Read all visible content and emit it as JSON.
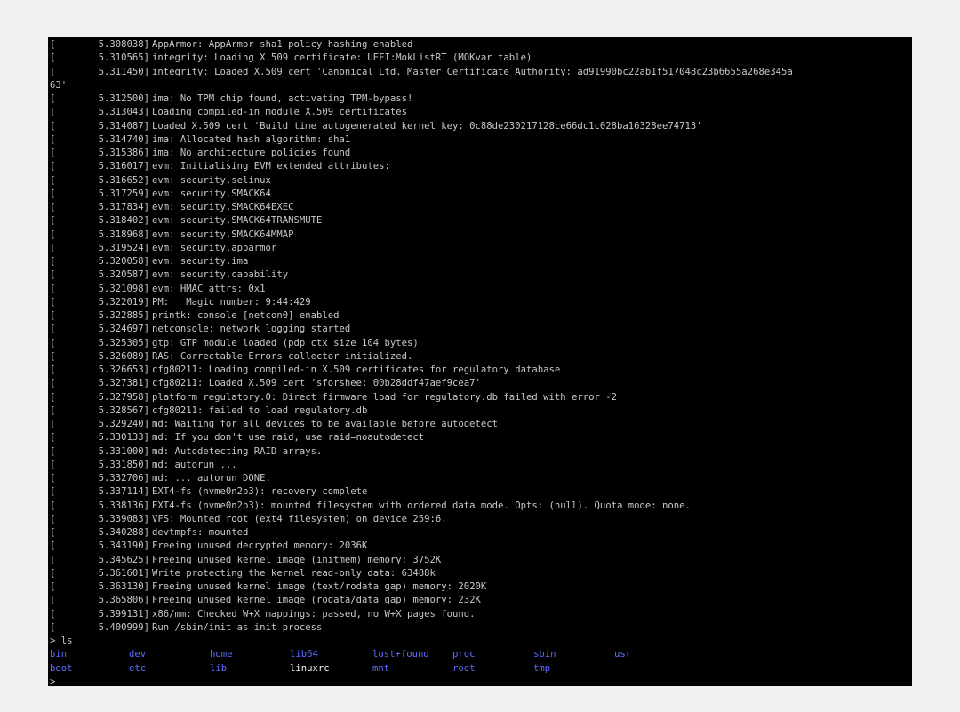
{
  "console": {
    "bracket": "[",
    "log_lines": [
      {
        "ts": "5.308038]",
        "msg": "AppArmor: AppArmor sha1 policy hashing enabled"
      },
      {
        "ts": "5.310565]",
        "msg": "integrity: Loading X.509 certificate: UEFI:MokListRT (MOKvar table)"
      },
      {
        "ts": "5.311450]",
        "msg": "integrity: Loaded X.509 cert 'Canonical Ltd. Master Certificate Authority: ad91990bc22ab1f517048c23b6655a268e345a"
      },
      {
        "wrap": "63'"
      },
      {
        "ts": "5.312500]",
        "msg": "ima: No TPM chip found, activating TPM-bypass!"
      },
      {
        "ts": "5.313043]",
        "msg": "Loading compiled-in module X.509 certificates"
      },
      {
        "ts": "5.314087]",
        "msg": "Loaded X.509 cert 'Build time autogenerated kernel key: 0c88de230217128ce66dc1c028ba16328ee74713'"
      },
      {
        "ts": "5.314740]",
        "msg": "ima: Allocated hash algorithm: sha1"
      },
      {
        "ts": "5.315386]",
        "msg": "ima: No architecture policies found"
      },
      {
        "ts": "5.316017]",
        "msg": "evm: Initialising EVM extended attributes:"
      },
      {
        "ts": "5.316652]",
        "msg": "evm: security.selinux"
      },
      {
        "ts": "5.317259]",
        "msg": "evm: security.SMACK64"
      },
      {
        "ts": "5.317834]",
        "msg": "evm: security.SMACK64EXEC"
      },
      {
        "ts": "5.318402]",
        "msg": "evm: security.SMACK64TRANSMUTE"
      },
      {
        "ts": "5.318968]",
        "msg": "evm: security.SMACK64MMAP"
      },
      {
        "ts": "5.319524]",
        "msg": "evm: security.apparmor"
      },
      {
        "ts": "5.320058]",
        "msg": "evm: security.ima"
      },
      {
        "ts": "5.320587]",
        "msg": "evm: security.capability"
      },
      {
        "ts": "5.321098]",
        "msg": "evm: HMAC attrs: 0x1"
      },
      {
        "ts": "5.322019]",
        "msg": "PM:   Magic number: 9:44:429"
      },
      {
        "ts": "5.322885]",
        "msg": "printk: console [netcon0] enabled"
      },
      {
        "ts": "5.324697]",
        "msg": "netconsole: network logging started"
      },
      {
        "ts": "5.325305]",
        "msg": "gtp: GTP module loaded (pdp ctx size 104 bytes)"
      },
      {
        "ts": "5.326089]",
        "msg": "RAS: Correctable Errors collector initialized."
      },
      {
        "ts": "5.326653]",
        "msg": "cfg80211: Loading compiled-in X.509 certificates for regulatory database"
      },
      {
        "ts": "5.327381]",
        "msg": "cfg80211: Loaded X.509 cert 'sforshee: 00b28ddf47aef9cea7'"
      },
      {
        "ts": "5.327958]",
        "msg": "platform regulatory.0: Direct firmware load for regulatory.db failed with error -2"
      },
      {
        "ts": "5.328567]",
        "msg": "cfg80211: failed to load regulatory.db"
      },
      {
        "ts": "5.329240]",
        "msg": "md: Waiting for all devices to be available before autodetect"
      },
      {
        "ts": "5.330133]",
        "msg": "md: If you don't use raid, use raid=noautodetect"
      },
      {
        "ts": "5.331000]",
        "msg": "md: Autodetecting RAID arrays."
      },
      {
        "ts": "5.331850]",
        "msg": "md: autorun ..."
      },
      {
        "ts": "5.332706]",
        "msg": "md: ... autorun DONE."
      },
      {
        "ts": "5.337114]",
        "msg": "EXT4-fs (nvme0n2p3): recovery complete"
      },
      {
        "ts": "5.338136]",
        "msg": "EXT4-fs (nvme0n2p3): mounted filesystem with ordered data mode. Opts: (null). Quota mode: none."
      },
      {
        "ts": "5.339083]",
        "msg": "VFS: Mounted root (ext4 filesystem) on device 259:6."
      },
      {
        "ts": "5.340288]",
        "msg": "devtmpfs: mounted"
      },
      {
        "ts": "5.343190]",
        "msg": "Freeing unused decrypted memory: 2036K"
      },
      {
        "ts": "5.345625]",
        "msg": "Freeing unused kernel image (initmem) memory: 3752K"
      },
      {
        "ts": "5.361601]",
        "msg": "Write protecting the kernel read-only data: 63488k"
      },
      {
        "ts": "5.363130]",
        "msg": "Freeing unused kernel image (text/rodata gap) memory: 2020K"
      },
      {
        "ts": "5.365806]",
        "msg": "Freeing unused kernel image (rodata/data gap) memory: 232K"
      },
      {
        "ts": "5.399131]",
        "msg": "x86/mm: Checked W+X mappings: passed, no W+X pages found."
      },
      {
        "ts": "5.400999]",
        "msg": "Run /sbin/init as init process"
      }
    ],
    "command": "> ls",
    "ls_rows": [
      [
        "bin",
        "dev",
        "home",
        "lib64",
        "lost+found",
        "proc",
        "sbin",
        "usr"
      ],
      [
        "boot",
        "etc",
        "lib",
        "linuxrc",
        "mnt",
        "root",
        "tmp"
      ]
    ],
    "executable": "linuxrc",
    "prompt": ">"
  },
  "colors": {
    "directory": "#5b6cff",
    "text": "#c8c8c8",
    "background": "#000000"
  }
}
